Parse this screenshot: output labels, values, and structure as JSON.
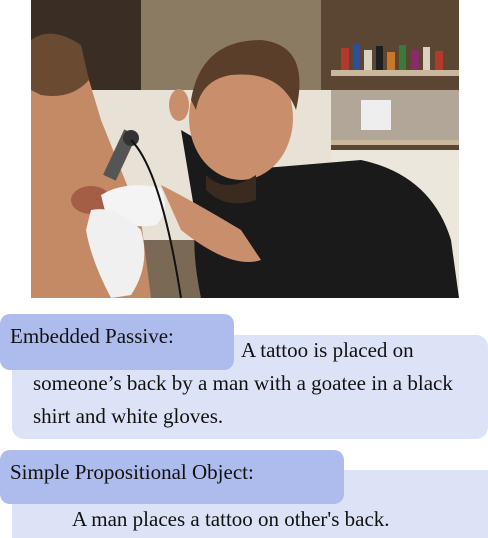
{
  "image": {
    "subject": "tattoo-artist-photo"
  },
  "captions": [
    {
      "label": "Embedded Passive:",
      "text_line1": "A tattoo is placed on",
      "text_rest": "someone’s back by a man with a goatee in a black shirt and white gloves."
    },
    {
      "label": "Simple Propositional Object:",
      "text": "A man places a tattoo on other's back."
    }
  ],
  "colors": {
    "panel_bg": "#dde3f7",
    "label_bg": "#aebbed"
  }
}
